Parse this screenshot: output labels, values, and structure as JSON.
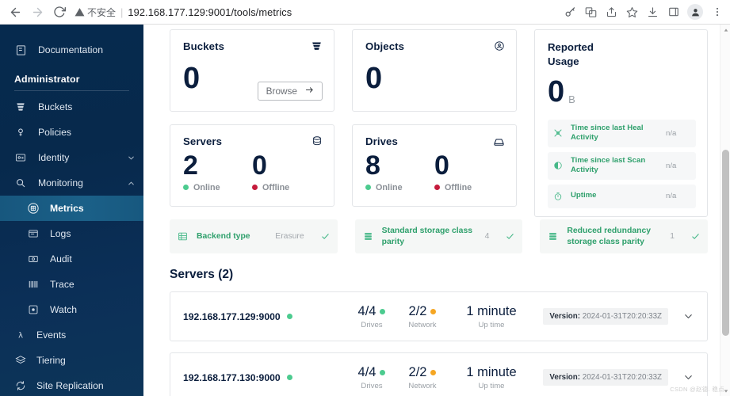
{
  "browser": {
    "back_icon": "back-arrow-icon",
    "forward_icon": "forward-arrow-icon",
    "reload_icon": "reload-icon",
    "security_label": "不安全",
    "separator": "|",
    "url": "192.168.177.129:9001/tools/metrics",
    "icons": [
      "key-icon",
      "translate-icon",
      "share-icon",
      "bookmark-star-icon",
      "download-icon",
      "side-panel-icon",
      "profile-icon",
      "more-menu-icon"
    ]
  },
  "sidebar": {
    "items": [
      {
        "label": "Documentation",
        "icon": "documentation-icon",
        "type": "item"
      }
    ],
    "section_title": "Administrator",
    "admin_items": [
      {
        "label": "Buckets",
        "icon": "buckets-icon",
        "type": "item",
        "expandable": false
      },
      {
        "label": "Policies",
        "icon": "policies-icon",
        "type": "item",
        "expandable": false
      },
      {
        "label": "Identity",
        "icon": "identity-icon",
        "type": "item",
        "expandable": true,
        "expanded": false
      },
      {
        "label": "Monitoring",
        "icon": "monitoring-search-icon",
        "type": "item",
        "expandable": true,
        "expanded": true
      }
    ],
    "monitoring_children": [
      {
        "label": "Metrics",
        "icon": "metrics-icon",
        "active": true
      },
      {
        "label": "Logs",
        "icon": "logs-icon",
        "active": false
      },
      {
        "label": "Audit",
        "icon": "audit-icon",
        "active": false
      },
      {
        "label": "Trace",
        "icon": "trace-icon",
        "active": false
      },
      {
        "label": "Watch",
        "icon": "watch-icon",
        "active": false
      }
    ],
    "tail_items": [
      {
        "label": "Events",
        "icon": "events-lambda-icon"
      },
      {
        "label": "Tiering",
        "icon": "tiering-icon"
      },
      {
        "label": "Site Replication",
        "icon": "site-replication-icon"
      }
    ]
  },
  "metrics": {
    "buckets": {
      "title": "Buckets",
      "value": "0",
      "icon": "bucket-icon",
      "browse_label": "Browse",
      "browse_arrow": "arrow-right-icon"
    },
    "objects": {
      "title": "Objects",
      "value": "0",
      "icon": "objects-icon"
    },
    "usage": {
      "title": "Reported Usage",
      "value": "0",
      "unit": "B",
      "rows": [
        {
          "label": "Time since last Heal Activity",
          "value": "n/a",
          "icon": "heal-icon"
        },
        {
          "label": "Time since last Scan Activity",
          "value": "n/a",
          "icon": "scan-icon"
        },
        {
          "label": "Uptime",
          "value": "n/a",
          "icon": "uptime-clock-icon"
        }
      ]
    },
    "servers": {
      "title": "Servers",
      "icon": "server-stack-icon",
      "online_value": "2",
      "online_label": "Online",
      "offline_value": "0",
      "offline_label": "Offline"
    },
    "drives": {
      "title": "Drives",
      "icon": "drive-icon",
      "online_value": "8",
      "online_label": "Online",
      "offline_value": "0",
      "offline_label": "Offline"
    },
    "status_chips": [
      {
        "label": "Backend type",
        "value": "Erasure",
        "icon": "backend-grid-icon",
        "check": "check-icon"
      },
      {
        "label": "Standard storage class parity",
        "value": "4",
        "icon": "storage-class-icon",
        "check": "check-icon"
      },
      {
        "label": "Reduced redundancy storage class parity",
        "value": "1",
        "icon": "storage-class-icon",
        "check": "check-icon"
      }
    ]
  },
  "servers_section": {
    "heading": "Servers (2)",
    "rows": [
      {
        "host": "192.168.177.129:9000",
        "status": "online",
        "drives_value": "4/4",
        "drives_label": "Drives",
        "drives_status": "green",
        "network_value": "2/2",
        "network_label": "Network",
        "network_status": "orange",
        "uptime_value": "1 minute",
        "uptime_label": "Up time",
        "version_prefix": "Version:",
        "version_value": "2024-01-31T20:20:33Z",
        "chevron": "chevron-down-icon"
      },
      {
        "host": "192.168.177.130:9000",
        "status": "online",
        "drives_value": "4/4",
        "drives_label": "Drives",
        "drives_status": "green",
        "network_value": "2/2",
        "network_label": "Network",
        "network_status": "orange",
        "uptime_value": "1 minute",
        "uptime_label": "Up time",
        "version_prefix": "Version:",
        "version_value": "2024-01-31T20:20:33Z",
        "chevron": "chevron-down-icon"
      }
    ]
  },
  "watermark": "CSDN @赵德. 稳点",
  "colors": {
    "sidebar_bg": "#072a4e",
    "active_item": "#1b6088",
    "navy_text": "#0b1e3d",
    "green": "#2fa06c",
    "dot_green": "#4ccb8f",
    "dot_red": "#c51b3c",
    "dot_orange": "#f5a623"
  }
}
